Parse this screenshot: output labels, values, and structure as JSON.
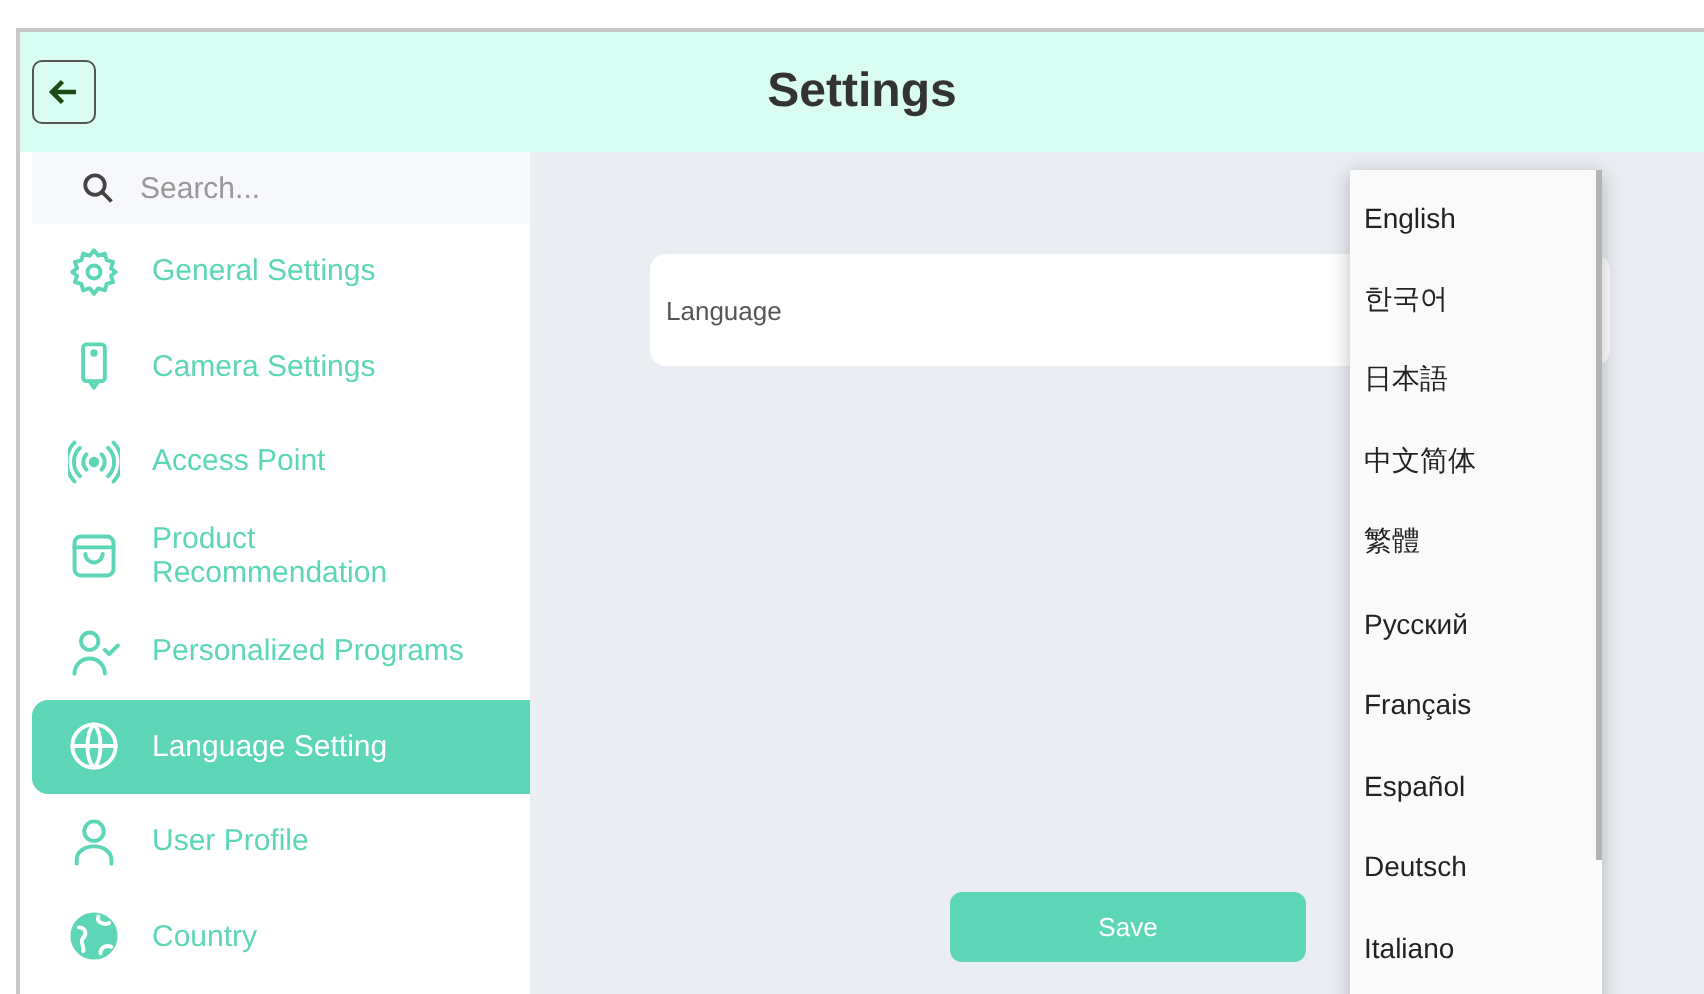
{
  "header": {
    "title": "Settings"
  },
  "sidebar": {
    "search": {
      "placeholder": "Search..."
    },
    "items": [
      {
        "label": "General Settings",
        "selected": false
      },
      {
        "label": "Camera Settings",
        "selected": false
      },
      {
        "label": "Access Point",
        "selected": false
      },
      {
        "label": "Product Recommendation",
        "selected": false
      },
      {
        "label": "Personalized Programs",
        "selected": false
      },
      {
        "label": "Language Setting",
        "selected": true
      },
      {
        "label": "User Profile",
        "selected": false
      },
      {
        "label": "Country",
        "selected": false
      }
    ]
  },
  "form": {
    "field_label": "Language",
    "save_button": "Save"
  },
  "dropdown": {
    "options": [
      "English",
      "한국어",
      "日本語",
      "中文简体",
      "繁體",
      "Русский",
      "Français",
      "Español",
      "Deutsch",
      "Italiano"
    ]
  }
}
